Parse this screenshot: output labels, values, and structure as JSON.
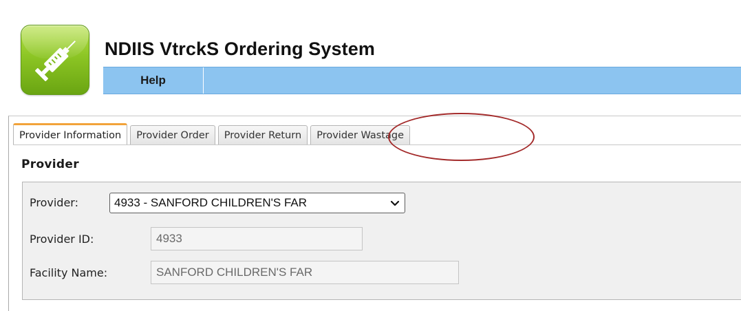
{
  "header": {
    "logo_icon": "syringe-icon",
    "title": "NDIIS VtrckS Ordering System",
    "menu": [
      {
        "label": "Help"
      }
    ],
    "menu_color": "#8cc4f0"
  },
  "tabs": [
    {
      "label": "Provider Information",
      "active": true
    },
    {
      "label": "Provider Order",
      "active": false
    },
    {
      "label": "Provider Return",
      "active": false
    },
    {
      "label": "Provider Wastage",
      "active": false,
      "highlighted": true
    }
  ],
  "section": {
    "title": "Provider"
  },
  "form": {
    "provider_label": "Provider:",
    "provider_selected": "4933 - SANFORD CHILDREN'S FAR",
    "provider_id_label": "Provider ID:",
    "provider_id_value": "4933",
    "facility_name_label": "Facility Name:",
    "facility_name_value": "SANFORD CHILDREN'S FAR"
  },
  "colors": {
    "active_tab_accent": "#f2a33a",
    "highlight_oval": "#a32a2a",
    "logo_green": "#8cc524"
  }
}
